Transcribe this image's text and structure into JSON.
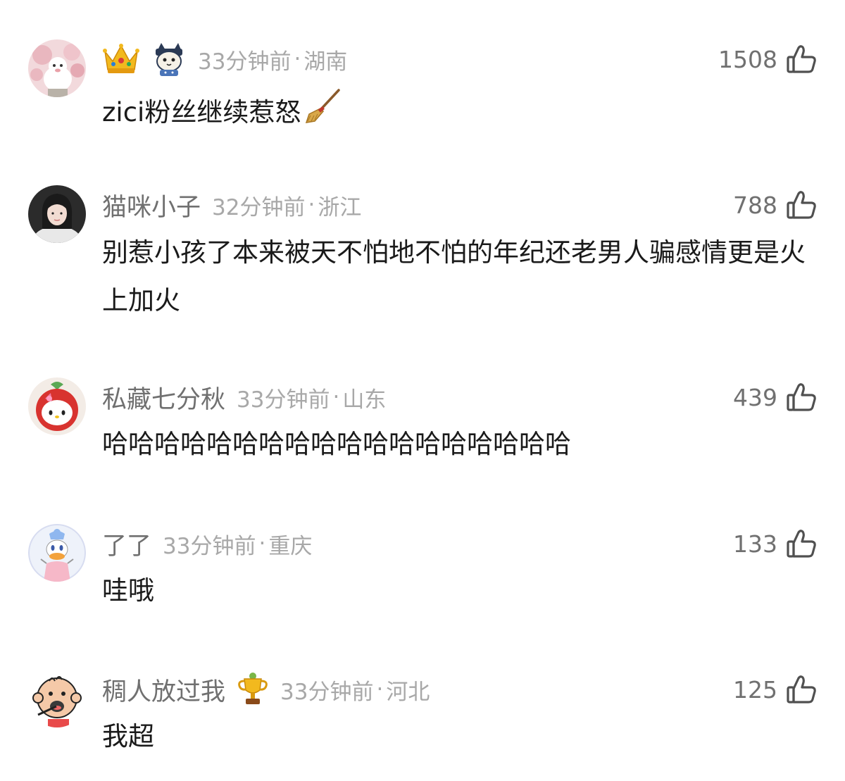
{
  "comments": [
    {
      "username": "",
      "time": "33分钟前",
      "separator": "·",
      "location": "湖南",
      "likes": "1508",
      "text": "zici粉丝继续惹怒",
      "badges": [
        "crown-icon",
        "cat-sticker-icon"
      ],
      "text_emoji": "broom-icon"
    },
    {
      "username": "猫咪小子",
      "time": "32分钟前",
      "separator": "·",
      "location": "浙江",
      "likes": "788",
      "text": "别惹小孩了本来被天不怕地不怕的年纪还老男人骗感情更是火上加火"
    },
    {
      "username": "私藏七分秋",
      "time": "33分钟前",
      "separator": "·",
      "location": "山东",
      "likes": "439",
      "text": "哈哈哈哈哈哈哈哈哈哈哈哈哈哈哈哈哈哈"
    },
    {
      "username": "了了",
      "time": "33分钟前",
      "separator": "·",
      "location": "重庆",
      "likes": "133",
      "text": "哇哦"
    },
    {
      "username": "稠人放过我",
      "time": "33分钟前",
      "separator": "·",
      "location": "河北",
      "likes": "125",
      "text": "我超",
      "badges": [
        "trophy-icon"
      ]
    }
  ],
  "icons": {
    "like": "thumbs-up-icon"
  },
  "colors": {
    "username": "#707070",
    "meta": "#a8a8a8",
    "text": "#1a1a1a",
    "background": "#ffffff"
  }
}
